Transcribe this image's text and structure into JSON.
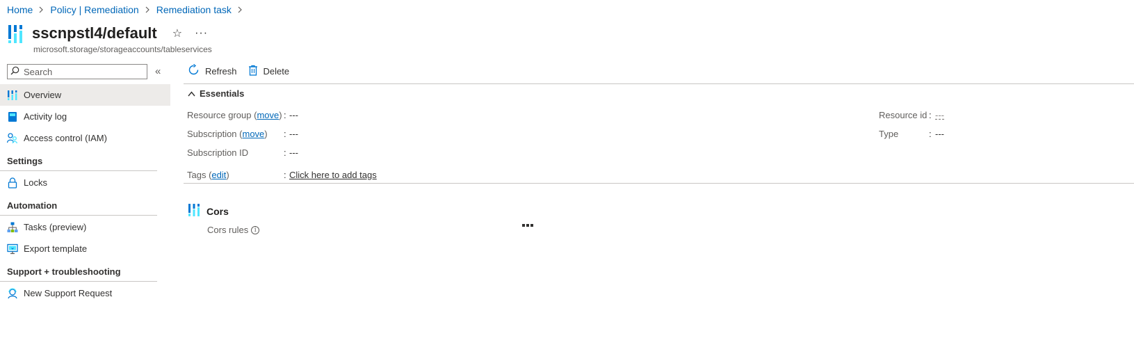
{
  "breadcrumb": [
    {
      "label": "Home"
    },
    {
      "label": "Policy | Remediation"
    },
    {
      "label": "Remediation task"
    }
  ],
  "header": {
    "title": "sscnpstl4/default",
    "subtitle": "microsoft.storage/storageaccounts/tableservices"
  },
  "search": {
    "placeholder": "Search"
  },
  "sidebar": {
    "items": [
      {
        "label": "Overview",
        "icon": "overview-icon",
        "selected": true
      },
      {
        "label": "Activity log",
        "icon": "activity-log-icon"
      },
      {
        "label": "Access control (IAM)",
        "icon": "iam-icon"
      }
    ],
    "sections": [
      {
        "title": "Settings",
        "items": [
          {
            "label": "Locks",
            "icon": "lock-icon"
          }
        ]
      },
      {
        "title": "Automation",
        "items": [
          {
            "label": "Tasks (preview)",
            "icon": "tasks-icon"
          },
          {
            "label": "Export template",
            "icon": "export-template-icon"
          }
        ]
      },
      {
        "title": "Support + troubleshooting",
        "items": [
          {
            "label": "New Support Request",
            "icon": "support-icon"
          }
        ]
      }
    ]
  },
  "toolbar": {
    "refresh_label": "Refresh",
    "delete_label": "Delete"
  },
  "essentials": {
    "label": "Essentials",
    "resource_group": {
      "label": "Resource group",
      "action": "move",
      "value": "---"
    },
    "subscription": {
      "label": "Subscription",
      "action": "move",
      "value": "---"
    },
    "subscription_id": {
      "label": "Subscription ID",
      "value": "---"
    },
    "tags": {
      "label": "Tags",
      "action": "edit",
      "value": "Click here to add tags"
    },
    "resource_id": {
      "label": "Resource id",
      "value": "---"
    },
    "type": {
      "label": "Type",
      "value": "---"
    }
  },
  "cors": {
    "title": "Cors",
    "rules_label": "Cors rules"
  },
  "colors": {
    "link": "#0067b8",
    "selected_bg": "#edebe9",
    "icon_blue": "#0078d4"
  }
}
